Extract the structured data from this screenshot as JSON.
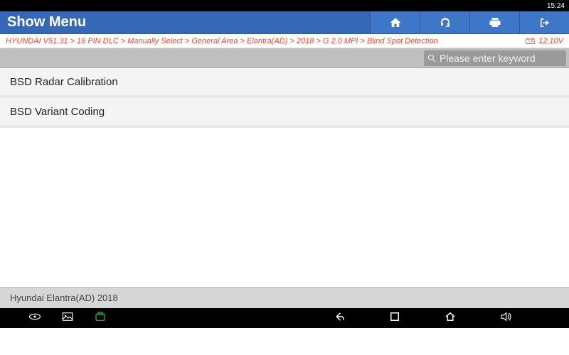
{
  "status": {
    "time": "15:24"
  },
  "header": {
    "title": "Show Menu"
  },
  "breadcrumb": "HYUNDAI V51.31 > 16 PIN DLC > Manually Select > General Area > Elantra(AD) > 2018 > G 2.0 MPI > Blind Spot Detection",
  "voltage": "12.10V",
  "search": {
    "placeholder": "Please enter keyword"
  },
  "menu": {
    "items": [
      {
        "label": "BSD Radar Calibration"
      },
      {
        "label": "BSD Variant Coding"
      }
    ]
  },
  "footer": {
    "vehicle": "Hyundai Elantra(AD) 2018"
  }
}
